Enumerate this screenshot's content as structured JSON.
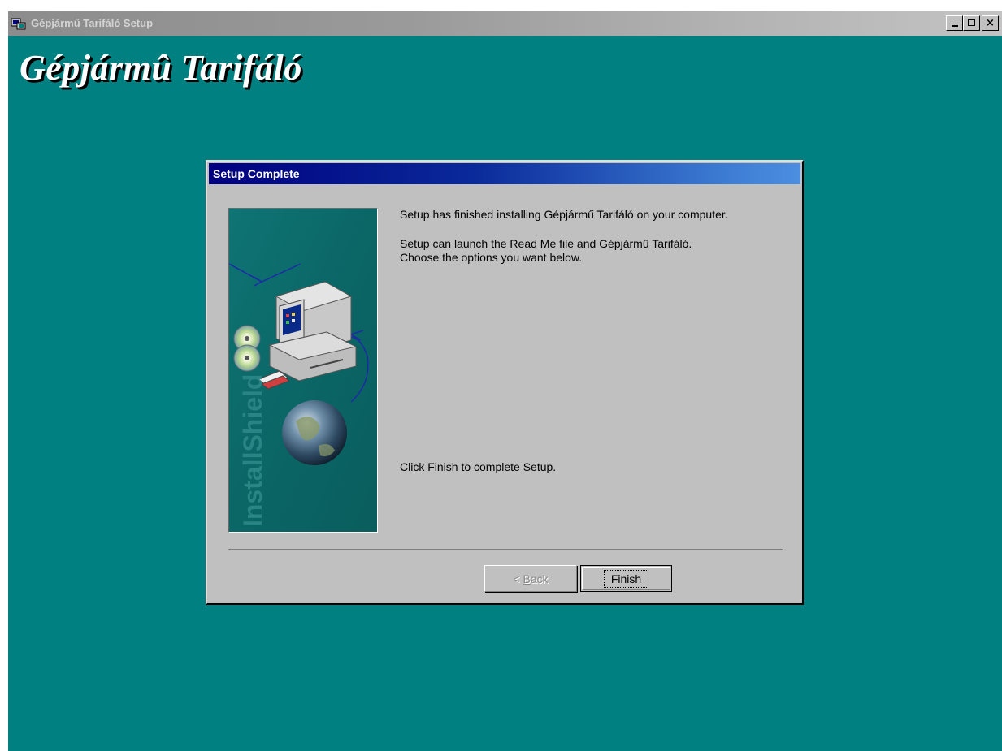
{
  "outer_window": {
    "title": "Gépjármű Tarifáló Setup",
    "banner_title": "Gépjármû Tarifáló",
    "controls": {
      "minimize_icon": "minimize-icon",
      "maximize_icon": "maximize-icon",
      "close_glyph": "×"
    }
  },
  "dialog": {
    "title": "Setup Complete",
    "side_image_text": "InstallShield",
    "messages": {
      "line1": "Setup has finished installing Gépjármű Tarifáló on your computer.",
      "line2": "Setup can launch the Read Me file and Gépjármű Tarifáló.",
      "line3": "Choose the options you want below.",
      "line4": "Click Finish to complete Setup."
    },
    "buttons": {
      "back_prefix": "< ",
      "back_mnemonic": "B",
      "back_rest": "ack",
      "back_enabled": false,
      "finish": "Finish"
    }
  },
  "colors": {
    "desktop_teal": "#008080",
    "dialog_gray": "#c0c0c0",
    "titlebar_navy": "#000080"
  }
}
